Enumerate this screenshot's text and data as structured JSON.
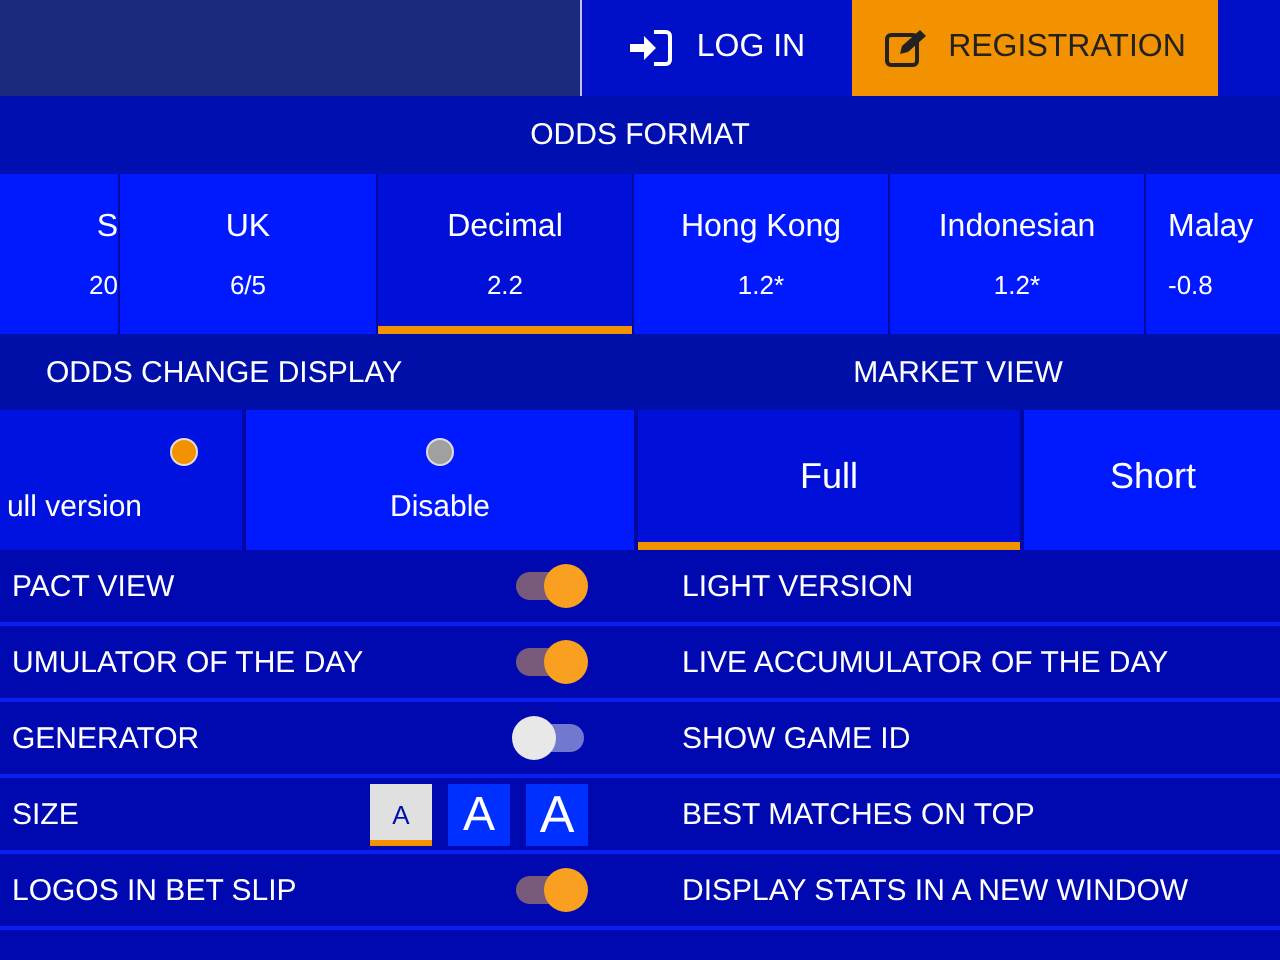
{
  "header": {
    "login": "LOG IN",
    "register": "REGISTRATION"
  },
  "odds_format": {
    "title": "ODDS FORMAT",
    "options": [
      {
        "label": "S",
        "value": "20",
        "selected": false
      },
      {
        "label": "UK",
        "value": "6/5",
        "selected": false
      },
      {
        "label": "Decimal",
        "value": "2.2",
        "selected": true
      },
      {
        "label": "Hong Kong",
        "value": "1.2*",
        "selected": false
      },
      {
        "label": "Indonesian",
        "value": "1.2*",
        "selected": false
      },
      {
        "label": "Malay",
        "value": "-0.8",
        "selected": false
      }
    ]
  },
  "odds_change_display": {
    "title": "ODDS CHANGE DISPLAY",
    "options": [
      {
        "label": "ull version",
        "selected": true
      },
      {
        "label": "Disable",
        "selected": false
      }
    ]
  },
  "market_view": {
    "title": "MARKET VIEW",
    "options": [
      {
        "label": "Full",
        "selected": true
      },
      {
        "label": "Short",
        "selected": false
      }
    ]
  },
  "settings_left": [
    {
      "kind": "toggle",
      "label": "PACT VIEW",
      "on": true
    },
    {
      "kind": "toggle",
      "label": "UMULATOR OF THE DAY",
      "on": true
    },
    {
      "kind": "toggle",
      "label": "GENERATOR",
      "on": false
    },
    {
      "kind": "font-size",
      "label": "SIZE",
      "options": [
        {
          "label": "A",
          "selected": true
        },
        {
          "label": "A",
          "selected": false
        },
        {
          "label": "A",
          "selected": false
        }
      ]
    },
    {
      "kind": "toggle",
      "label": "LOGOS IN BET SLIP",
      "on": true
    }
  ],
  "settings_right": [
    {
      "label": "LIGHT VERSION"
    },
    {
      "label": "LIVE ACCUMULATOR OF THE DAY"
    },
    {
      "label": "SHOW GAME ID"
    },
    {
      "label": "BEST MATCHES ON TOP"
    },
    {
      "label": "DISPLAY STATS IN A NEW WINDOW"
    }
  ]
}
